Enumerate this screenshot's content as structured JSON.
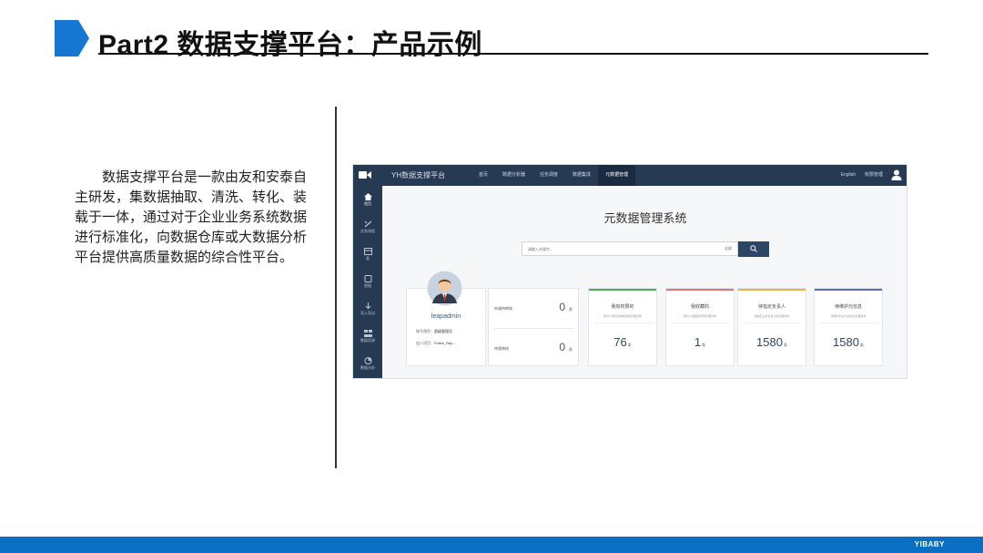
{
  "header": {
    "title": "Part2 数据支撑平台：产品示例"
  },
  "intro": {
    "text": "数据支撑平台是一款由友和安泰自主研发，集数据抽取、清洗、转化、装载于一体，通过对于企业业务系统数据进行标准化，向数据仓库或大数据分析平台提供高质量数据的综合性平台。"
  },
  "app": {
    "title": "YH数据支撑平台",
    "nav": [
      "首页",
      "数据分析器",
      "任务调度",
      "数据集成",
      "元数据管理"
    ],
    "top_links": [
      "English",
      "权限管理"
    ],
    "sidebar": [
      "首页",
      "业务流程",
      "表",
      "视图",
      "导入导出",
      "数据资源",
      "数据分析"
    ],
    "main_title": "元数据管理系统",
    "search": {
      "placeholder": "请输入关键字...",
      "select": "全部"
    },
    "user": {
      "name": "leapadmin",
      "role_label": "账号角色：",
      "role": "超级管理员",
      "project_label": "加入项目：",
      "project": "Public_Rep..."
    },
    "approvals": [
      {
        "label": "申请待审核",
        "value": "0",
        "unit": "条"
      },
      {
        "label": "待我审核",
        "value": "0",
        "unit": "条"
      }
    ],
    "stats": [
      {
        "title": "我有权限的",
        "desc": "我可以申请查看权限的管理对象",
        "value": "76",
        "unit": "条",
        "color": "#4caf50"
      },
      {
        "title": "我收藏的",
        "desc": "我可以收藏的所有管理对象",
        "value": "1",
        "unit": "条",
        "color": "#e57373"
      },
      {
        "title": "待指定负责人",
        "desc": "待指定业务负责人的管理对象",
        "value": "1580",
        "unit": "条",
        "color": "#f5b041"
      },
      {
        "title": "待维护元信息",
        "desc": "待维护补充元信息的管理对象",
        "value": "1580",
        "unit": "条",
        "color": "#5c6bc0"
      }
    ]
  },
  "footer": {
    "brand": "YIBABY"
  },
  "colors": {
    "accent": "#0a6fc2",
    "nav_bg": "#273a54"
  },
  "icons": [
    "chevron-marker-icon",
    "logo-icon",
    "user-icon",
    "home-icon",
    "search-icon",
    "avatar-icon"
  ]
}
